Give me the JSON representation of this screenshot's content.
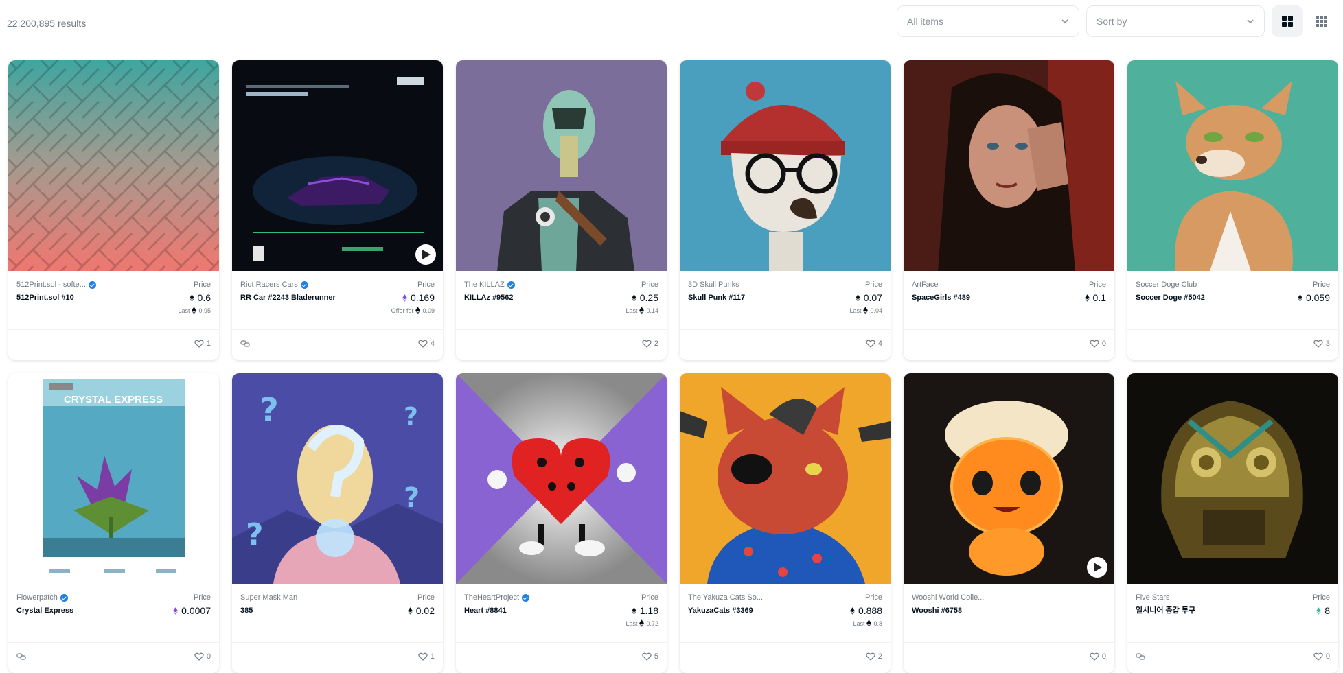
{
  "header": {
    "results_count": "22,200,895 results",
    "filter_select": {
      "value": "All items",
      "icon": "chevron-down-icon"
    },
    "sort_select": {
      "placeholder": "Sort by",
      "icon": "chevron-down-icon"
    },
    "view_large": {
      "icon": "large-grid-icon"
    },
    "view_small": {
      "icon": "small-grid-icon"
    }
  },
  "eth_icon": "ethereum-icon",
  "cards": [
    {
      "collection": "512Print.sol - softe...",
      "verified": true,
      "name": "512Print.sol #10",
      "price_label": "Price",
      "price": "0.6",
      "sub_label": "Last",
      "sub_value": "0.95",
      "likes": "1",
      "chain_icon": false,
      "art": "maze"
    },
    {
      "collection": "Riot Racers Cars",
      "verified": true,
      "name": "RR Car #2243 Bladerunner",
      "price_label": "Price",
      "price": "0.169",
      "sub_label": "Offer for",
      "sub_value": "0.09",
      "likes": "4",
      "chain_icon": true,
      "art": "blade"
    },
    {
      "collection": "The KILLAZ",
      "verified": true,
      "name": "KILLAz #9562",
      "price_label": "Price",
      "price": "0.25",
      "sub_label": "Last",
      "sub_value": "0.14",
      "likes": "2",
      "chain_icon": false,
      "art": "killaz"
    },
    {
      "collection": "3D Skull Punks",
      "verified": false,
      "name": "Skull Punk #117",
      "price_label": "Price",
      "price": "0.07",
      "sub_label": "Last",
      "sub_value": "0.04",
      "likes": "4",
      "chain_icon": false,
      "art": "skull"
    },
    {
      "collection": "ArtFace",
      "verified": false,
      "name": "SpaceGirls #489",
      "price_label": "Price",
      "price": "0.1",
      "sub_label": "",
      "sub_value": "",
      "likes": "0",
      "chain_icon": false,
      "art": "girl"
    },
    {
      "collection": "Soccer Doge Club",
      "verified": false,
      "name": "Soccer Doge #5042",
      "price_label": "Price",
      "price": "0.059",
      "sub_label": "",
      "sub_value": "",
      "likes": "3",
      "chain_icon": false,
      "art": "doge"
    },
    {
      "collection": "Flowerpatch",
      "verified": true,
      "name": "Crystal Express",
      "price_label": "Price",
      "price": "0.0007",
      "sub_label": "",
      "sub_value": "",
      "likes": "0",
      "chain_icon": true,
      "art": "crystal",
      "art_text": "CRYSTAL EXPRESS"
    },
    {
      "collection": "Super Mask Man",
      "verified": false,
      "name": "385",
      "price_label": "Price",
      "price": "0.02",
      "sub_label": "",
      "sub_value": "",
      "likes": "1",
      "chain_icon": false,
      "art": "mask"
    },
    {
      "collection": "TheHeartProject",
      "verified": true,
      "name": "Heart #8841",
      "price_label": "Price",
      "price": "1.18",
      "sub_label": "Last",
      "sub_value": "0.72",
      "likes": "5",
      "chain_icon": false,
      "art": "heart"
    },
    {
      "collection": "The Yakuza Cats So...",
      "verified": false,
      "name": "YakuzaCats #3369",
      "price_label": "Price",
      "price": "0.888",
      "sub_label": "Last",
      "sub_value": "0.8",
      "likes": "2",
      "chain_icon": false,
      "art": "cat"
    },
    {
      "collection": "Wooshi World Colle...",
      "verified": false,
      "name": "Wooshi #6758",
      "price_label": "",
      "price": "",
      "sub_label": "",
      "sub_value": "",
      "likes": "0",
      "chain_icon": false,
      "art": "wooshi"
    },
    {
      "collection": "Five Stars",
      "verified": false,
      "name": "일시니어 중갑 투구",
      "price_label": "Price",
      "price": "8",
      "sub_label": "",
      "sub_value": "",
      "likes": "0",
      "chain_icon": true,
      "art": "helmet"
    }
  ],
  "colors": {
    "accent": "#2081e2",
    "text": "#04111d",
    "muted": "#707a83"
  }
}
